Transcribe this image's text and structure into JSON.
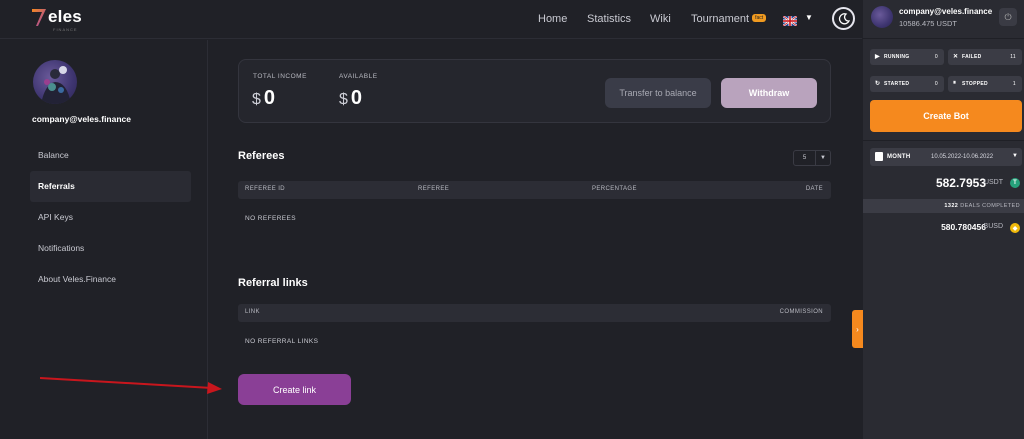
{
  "app": {
    "logo_text": "eles",
    "logo_sub": "FINANCE"
  },
  "nav": {
    "items": [
      "Home",
      "Statistics",
      "Wiki",
      "Tournament"
    ],
    "tournament_badge": "fact",
    "language": "EN"
  },
  "user": {
    "email": "company@veles.finance",
    "balance": "10586.475 USDT"
  },
  "sidebar": {
    "items": [
      {
        "label": "Balance",
        "active": false
      },
      {
        "label": "Referrals",
        "active": true
      },
      {
        "label": "API Keys",
        "active": false
      },
      {
        "label": "Notifications",
        "active": false
      },
      {
        "label": "About Veles.Finance",
        "active": false
      }
    ]
  },
  "income": {
    "total_label": "TOTAL INCOME",
    "total_currency": "$",
    "total_value": "0",
    "available_label": "AVAILABLE",
    "available_currency": "$",
    "available_value": "0",
    "transfer_label": "Transfer to balance",
    "withdraw_label": "Withdraw"
  },
  "referees": {
    "title": "Referees",
    "page_size": "5",
    "columns": [
      "REFEREE ID",
      "REFEREE",
      "PERCENTAGE",
      "DATE"
    ],
    "empty_text": "NO REFEREES"
  },
  "referral_links": {
    "title": "Referral links",
    "columns": [
      "LINK",
      "COMMISSION"
    ],
    "empty_text": "NO REFERRAL LINKS",
    "create_label": "Create link"
  },
  "bots": {
    "running": {
      "label": "RUNNING",
      "count": "0"
    },
    "failed": {
      "label": "FAILED",
      "count": "11"
    },
    "started": {
      "label": "STARTED",
      "count": "0"
    },
    "stopped": {
      "label": "STOPPED",
      "count": "1"
    },
    "create_label": "Create Bot"
  },
  "period": {
    "label": "MONTH",
    "range": "10.05.2022-10.06.2022"
  },
  "totals": {
    "usdt_value": "582.7953",
    "usdt_currency": "USDT",
    "deals_count": "1322",
    "deals_label": "DEALS COMPLETED",
    "busd_value": "580.780456",
    "busd_currency": "BUSD"
  },
  "colors": {
    "accent_orange": "#f5891e",
    "accent_purple": "#8a3f96",
    "withdraw": "#b9a3bd",
    "usdt_coin": "#26a17b",
    "busd_coin": "#f0b90b",
    "annotation_red": "#c8161d"
  },
  "icons": {
    "theme_toggle": "moon-icon",
    "power": "power-icon",
    "panel_toggle": "chevron-right-icon"
  }
}
